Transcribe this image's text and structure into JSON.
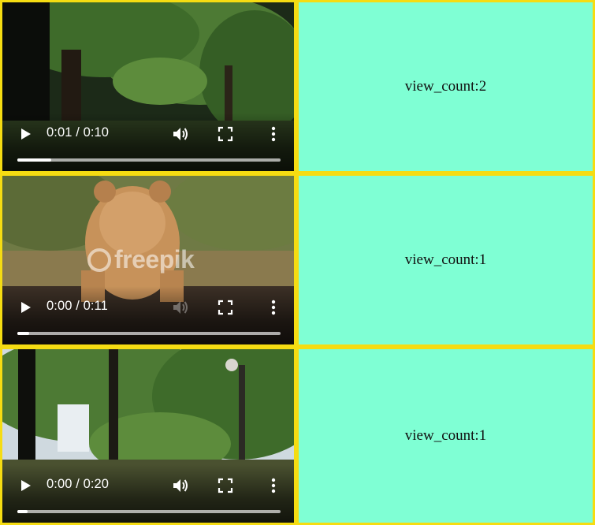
{
  "rows": [
    {
      "video": {
        "time": "0:01 / 0:10",
        "progress": 0.13,
        "muted_icon": false
      },
      "view_count": "view_count:2"
    },
    {
      "video": {
        "time": "0:00 / 0:11",
        "progress": 0.045,
        "watermark": "freepik"
      },
      "view_count": "view_count:1"
    },
    {
      "video": {
        "time": "0:00 / 0:20",
        "progress": 0.04
      },
      "view_count": "view_count:1"
    }
  ],
  "icons": [
    "play-icon",
    "volume-icon",
    "fullscreen-icon",
    "more-vertical-icon"
  ],
  "colors": {
    "cell_border": "#f5dc12",
    "info_bg": "#7fffd4",
    "video_bg": "#0f0f10",
    "control_text": "#ffffff"
  }
}
